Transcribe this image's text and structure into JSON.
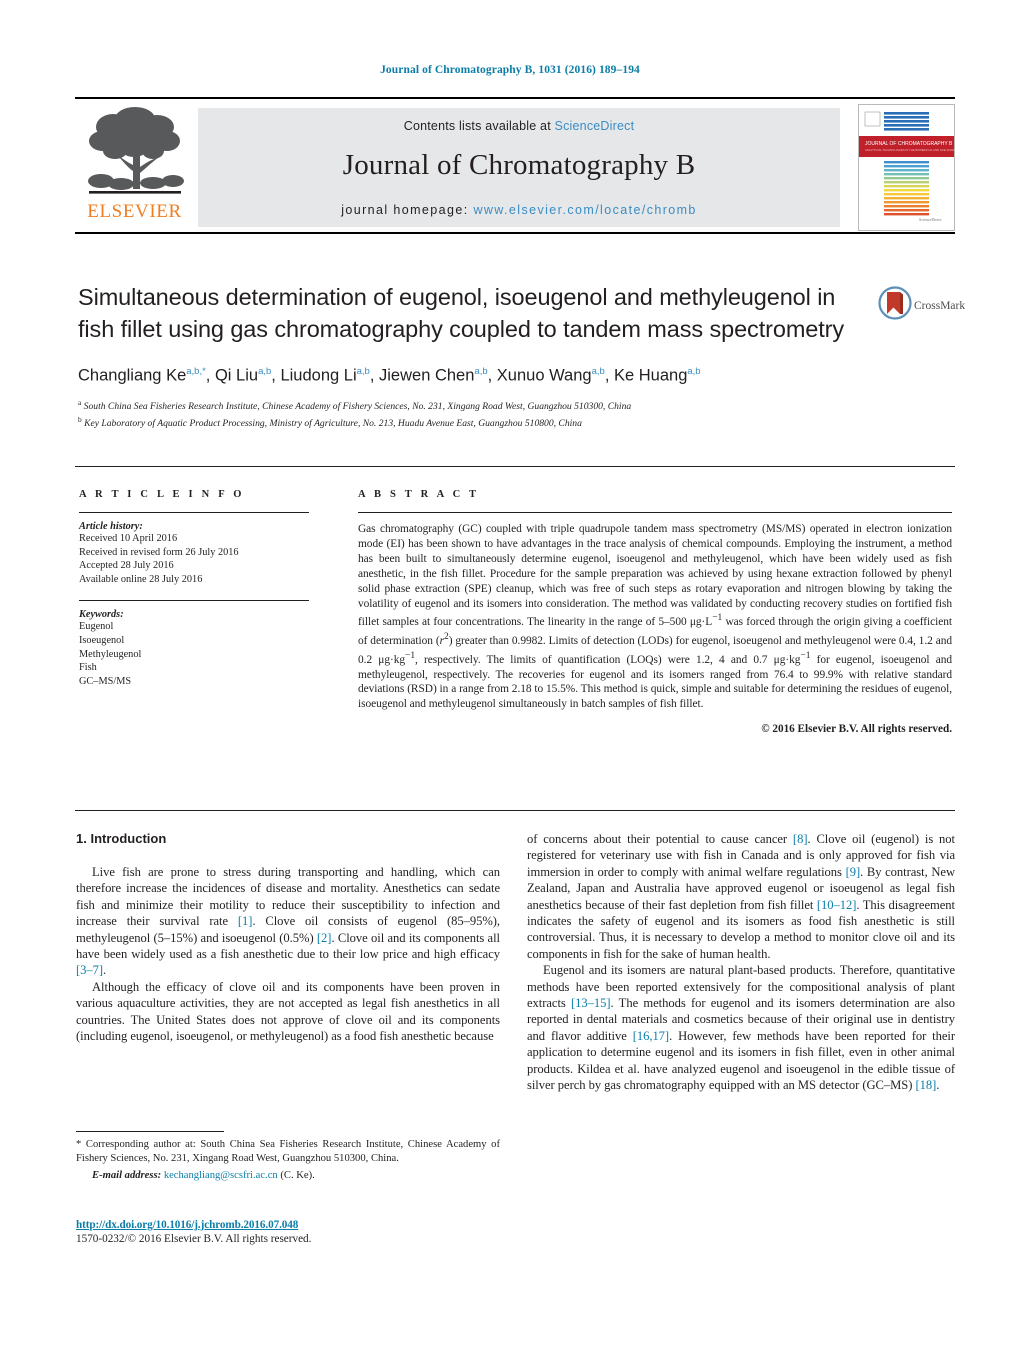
{
  "running_head": "Journal of Chromatography B, 1031 (2016) 189–194",
  "masthead": {
    "contents_prefix": "Contents lists available at ",
    "contents_link": "ScienceDirect",
    "journal_title": "Journal of Chromatography B",
    "homepage_prefix": "journal homepage: ",
    "homepage_url": "www.elsevier.com/locate/chromb",
    "publisher_wordmark": "ELSEVIER",
    "publisher_logo_icon": "elsevier-tree-icon",
    "cover_icon": "journal-cover-thumbnail",
    "cover_banner_text": "JOURNAL OF CHROMATOGRAPHY B",
    "accent_link_color": "#3a8dc4",
    "band_color": "#e6e7e8",
    "elsevier_orange": "#ef7d22"
  },
  "crossmark": {
    "label": "CrossMark",
    "icon": "crossmark-icon"
  },
  "article": {
    "title": "Simultaneous determination of eugenol, isoeugenol and methyleugenol in fish fillet using gas chromatography coupled to tandem mass spectrometry",
    "authors": [
      {
        "name": "Changliang Ke",
        "sup": "a,b,*"
      },
      {
        "name": "Qi Liu",
        "sup": "a,b"
      },
      {
        "name": "Liudong Li",
        "sup": "a,b"
      },
      {
        "name": "Jiewen Chen",
        "sup": "a,b"
      },
      {
        "name": "Xunuo Wang",
        "sup": "a,b"
      },
      {
        "name": "Ke Huang",
        "sup": "a,b"
      }
    ],
    "affiliations": [
      {
        "mark": "a",
        "text": "South China Sea Fisheries Research Institute, Chinese Academy of Fishery Sciences, No. 231, Xingang Road West, Guangzhou 510300, China"
      },
      {
        "mark": "b",
        "text": "Key Laboratory of Aquatic Product Processing, Ministry of Agriculture, No. 213, Huadu Avenue East, Guangzhou 510800, China"
      }
    ]
  },
  "article_info": {
    "heading": "A R T I C L E    I N F O",
    "history_label": "Article history:",
    "history": [
      "Received 10 April 2016",
      "Received in revised form 26 July 2016",
      "Accepted 28 July 2016",
      "Available online 28 July 2016"
    ],
    "keywords_label": "Keywords:",
    "keywords": [
      "Eugenol",
      "Isoeugenol",
      "Methyleugenol",
      "Fish",
      "GC–MS/MS"
    ]
  },
  "abstract": {
    "heading": "A B S T R A C T",
    "text": "Gas chromatography (GC) coupled with triple quadrupole tandem mass spectrometry (MS/MS) operated in electron ionization mode (EI) has been shown to have advantages in the trace analysis of chemical compounds. Employing the instrument, a method has been built to simultaneously determine eugenol, isoeugenol and methyleugenol, which have been widely used as fish anesthetic, in the fish fillet. Procedure for the sample preparation was achieved by using hexane extraction followed by phenyl solid phase extraction (SPE) cleanup, which was free of such steps as rotary evaporation and nitrogen blowing by taking the volatility of eugenol and its isomers into consideration. The method was validated by conducting recovery studies on fortified fish fillet samples at four concentrations. The linearity in the range of 5–500 μg·L−1 was forced through the origin giving a coefficient of determination (r2) greater than 0.9982. Limits of detection (LODs) for eugenol, isoeugenol and methyleugenol were 0.4, 1.2 and 0.2 μg·kg−1, respectively. The limits of quantification (LOQs) were 1.2, 4 and 0.7 μg·kg−1 for eugenol, isoeugenol and methyleugenol, respectively. The recoveries for eugenol and its isomers ranged from 76.4 to 99.9% with relative standard deviations (RSD) in a range from 2.18 to 15.5%. This method is quick, simple and suitable for determining the residues of eugenol, isoeugenol and methyleugenol simultaneously in batch samples of fish fillet.",
    "copyright": "© 2016 Elsevier B.V. All rights reserved."
  },
  "body": {
    "section_heading": "1. Introduction",
    "left_paragraphs": [
      "Live fish are prone to stress during transporting and handling, which can therefore increase the incidences of disease and mortality. Anesthetics can sedate fish and minimize their motility to reduce their susceptibility to infection and increase their survival rate [1]. Clove oil consists of eugenol (85–95%), methyleugenol (5–15%) and isoeugenol (0.5%) [2]. Clove oil and its components all have been widely used as a fish anesthetic due to their low price and high efficacy [3–7].",
      "Although the efficacy of clove oil and its components have been proven in various aquaculture activities, they are not accepted as legal fish anesthetics in all countries. The United States does not approve of clove oil and its components (including eugenol, isoeugenol, or methyleugenol) as a food fish anesthetic because"
    ],
    "right_paragraphs": [
      "of concerns about their potential to cause cancer [8]. Clove oil (eugenol) is not registered for veterinary use with fish in Canada and is only approved for fish via immersion in order to comply with animal welfare regulations [9]. By contrast, New Zealand, Japan and Australia have approved eugenol or isoeugenol as legal fish anesthetics because of their fast depletion from fish fillet [10–12]. This disagreement indicates the safety of eugenol and its isomers as food fish anesthetic is still controversial. Thus, it is necessary to develop a method to monitor clove oil and its components in fish for the sake of human health.",
      "Eugenol and its isomers are natural plant-based products. Therefore, quantitative methods have been reported extensively for the compositional analysis of plant extracts [13–15]. The methods for eugenol and its isomers determination are also reported in dental materials and cosmetics because of their original use in dentistry and flavor additive [16,17]. However, few methods have been reported for their application to determine eugenol and its isomers in fish fillet, even in other animal products. Kildea et al. have analyzed eugenol and isoeugenol in the edible tissue of silver perch by gas chromatography equipped with an MS detector (GC–MS) [18]."
    ],
    "reference_link_color": "#0b7ea8"
  },
  "footnote": {
    "corresponding": "* Corresponding author at: South China Sea Fisheries Research Institute, Chinese Academy of Fishery Sciences, No. 231, Xingang Road West, Guangzhou 510300, China.",
    "email_label": "E-mail address:",
    "email": "kechangliang@scsfri.ac.cn",
    "email_suffix": "(C. Ke).",
    "doi": "http://dx.doi.org/10.1016/j.jchromb.2016.07.048",
    "issn": "1570-0232/© 2016 Elsevier B.V. All rights reserved."
  }
}
